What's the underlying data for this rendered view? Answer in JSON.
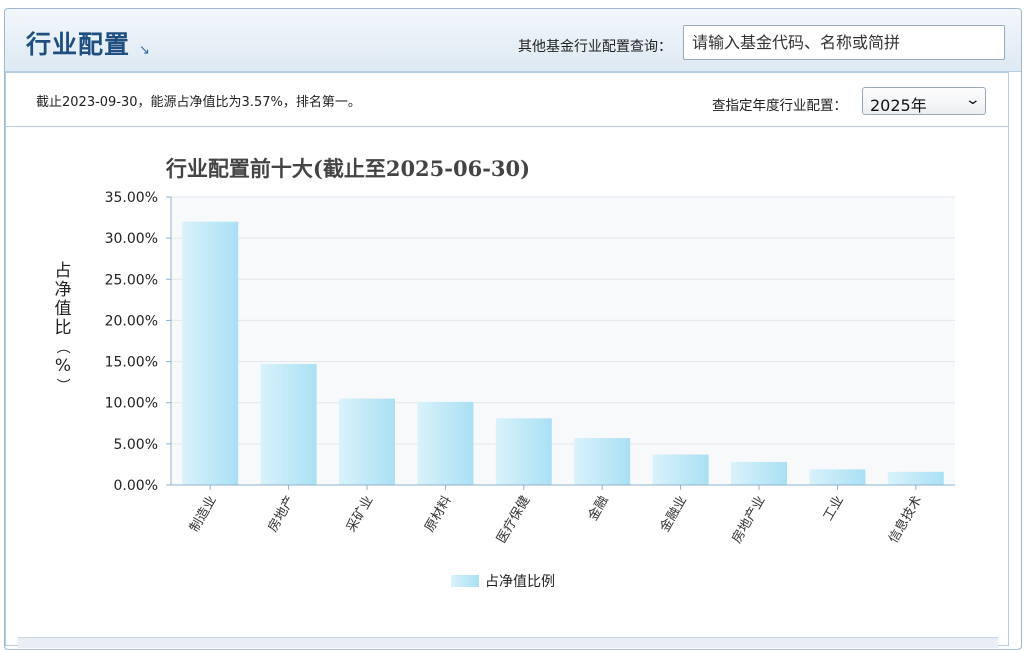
{
  "header": {
    "title": "行业配置",
    "title_arrow": "↘",
    "search_label": "其他基金行业配置查询：",
    "search_placeholder": "请输入基金代码、名称或简拼"
  },
  "info": {
    "summary": "截止2023-09-30，能源占净值比为3.57%，排名第一。",
    "year_label": "查指定年度行业配置：",
    "year_value": "2025年"
  },
  "colors": {
    "accent": "#1f4f80",
    "bar_light": "#d9f2fb",
    "bar_dark": "#a9e0f3"
  },
  "chart_data": {
    "type": "bar",
    "title": "行业配置前十大(截止至2025-06-30)",
    "ylabel": "占净值比（%）",
    "xlabel": "",
    "categories": [
      "制造业",
      "房地产",
      "采矿业",
      "原材料",
      "医疗保健",
      "金融",
      "金融业",
      "房地产业",
      "工业",
      "信息技术"
    ],
    "series": [
      {
        "name": "占净值比例",
        "values": [
          32.0,
          14.7,
          10.5,
          10.1,
          8.1,
          5.7,
          3.7,
          2.8,
          1.9,
          1.6
        ]
      }
    ],
    "ylim": [
      0,
      35
    ],
    "yticks": [
      "0.00%",
      "5.00%",
      "10.00%",
      "15.00%",
      "20.00%",
      "25.00%",
      "30.00%",
      "35.00%"
    ],
    "grid": true,
    "legend": "bottom"
  }
}
